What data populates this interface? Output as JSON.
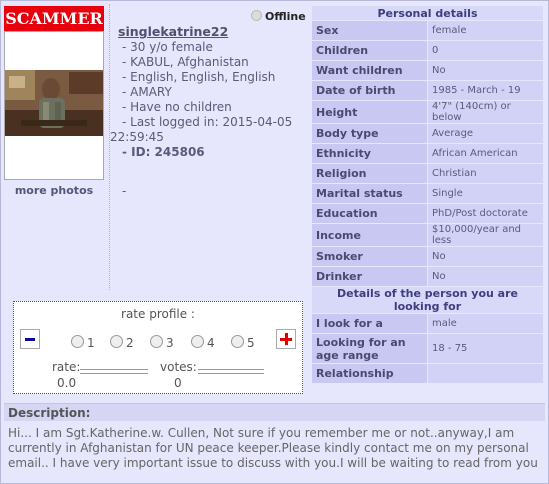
{
  "badge": "SCAMMER",
  "more_photos": "more photos",
  "status": "Offline",
  "profile": {
    "username": "singlekatrine22",
    "lines": [
      "- 30 y/o female",
      "- KABUL, Afghanistan",
      "- English, English, English",
      "- AMARY",
      "- Have no children",
      "- Last logged in: 2015-04-05",
      "22:59:45"
    ],
    "id_label": "- ID: 245806",
    "dash": "-"
  },
  "personal_details": {
    "title": "Personal details",
    "rows": [
      {
        "k": "Sex",
        "v": "female"
      },
      {
        "k": "Children",
        "v": "0"
      },
      {
        "k": "Want children",
        "v": "No"
      },
      {
        "k": "Date of birth",
        "v": "1985 - March - 19"
      },
      {
        "k": "Height",
        "v": "4'7\" (140cm) or below"
      },
      {
        "k": "Body type",
        "v": "Average"
      },
      {
        "k": "Ethnicity",
        "v": "African American"
      },
      {
        "k": "Religion",
        "v": "Christian"
      },
      {
        "k": "Marital status",
        "v": "Single"
      },
      {
        "k": "Education",
        "v": "PhD/Post doctorate"
      },
      {
        "k": "Income",
        "v": "$10,000/year and less"
      },
      {
        "k": "Smoker",
        "v": "No"
      },
      {
        "k": "Drinker",
        "v": "No"
      }
    ]
  },
  "looking_for": {
    "title": "Details of the person you are looking for",
    "rows": [
      {
        "k": "I look for a",
        "v": "male"
      },
      {
        "k": "Looking for an age range",
        "v": "18 -  75"
      },
      {
        "k": "Relationship",
        "v": ""
      }
    ]
  },
  "rating": {
    "title": "rate profile :",
    "options": [
      "1",
      "2",
      "3",
      "4",
      "5"
    ],
    "rate_label": "rate:",
    "rate_value": "0.0",
    "votes_label": "votes:",
    "votes_value": "0"
  },
  "description": {
    "title": "Description:",
    "text": "Hi... I am Sgt.Katherine.w. Cullen, Not sure if you remember me or not..anyway,I am currently in Afghanistan for UN peace keeper.Please kindly contact me on my personal email.. I have very important issue to discuss with you.I will be waiting to read from you"
  },
  "colors": {
    "badge_bg": "#e8000c",
    "page_bg": "#e6e6fc",
    "table_key_bg": "#c8c8f2",
    "table_val_bg": "#d2d2f6"
  }
}
